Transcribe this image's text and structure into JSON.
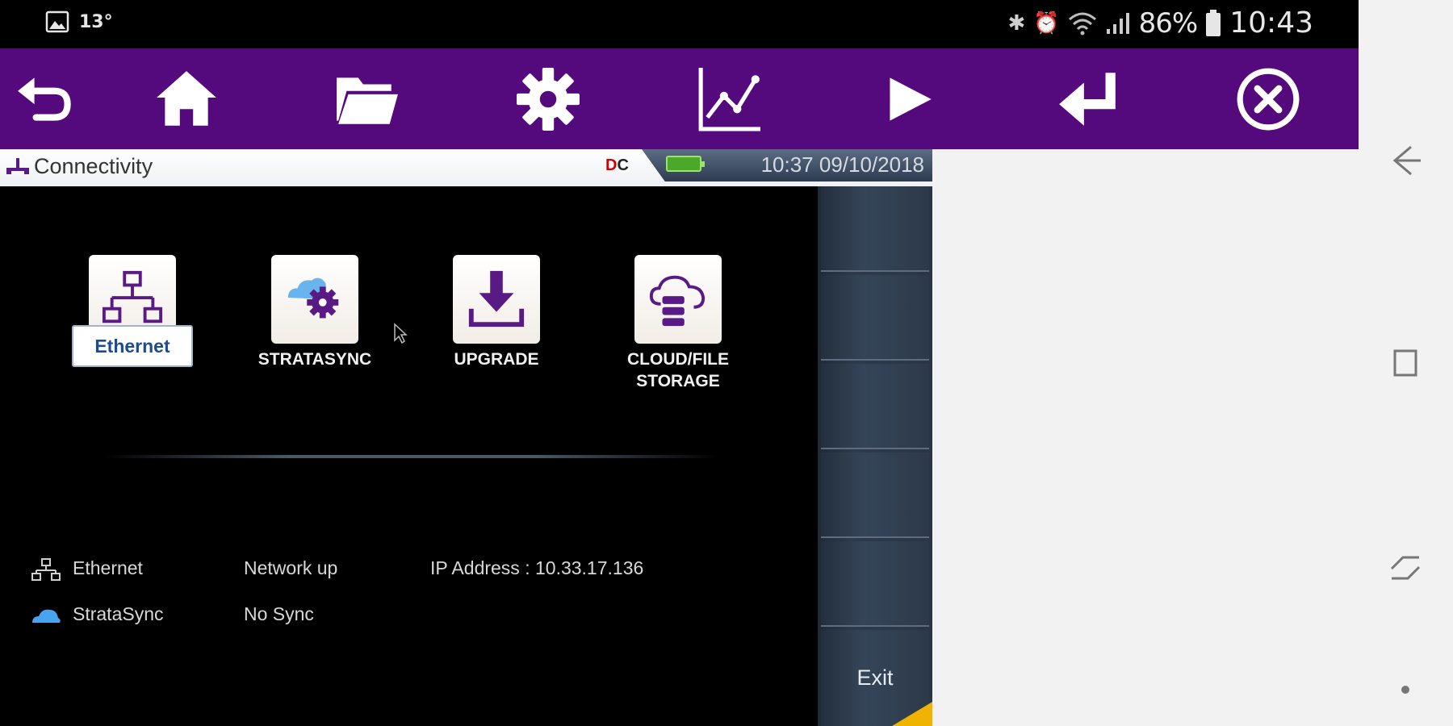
{
  "status_bar": {
    "temperature": "13°",
    "battery_percent": "86%",
    "clock": "10:43"
  },
  "toolbar": {
    "buttons": [
      {
        "name": "back-arrow-icon"
      },
      {
        "name": "home-icon"
      },
      {
        "name": "folder-icon"
      },
      {
        "name": "gear-icon"
      },
      {
        "name": "chart-icon"
      },
      {
        "name": "play-icon"
      },
      {
        "name": "enter-icon"
      },
      {
        "name": "close-circle-icon"
      }
    ],
    "color": "#540a7c"
  },
  "device": {
    "title": "Connectivity",
    "badge_prefix": "D",
    "badge_suffix": "C",
    "datetime": "10:37  09/10/2018",
    "tiles": [
      {
        "label": "Ethernet"
      },
      {
        "label": "STRATASYNC"
      },
      {
        "label": "UPGRADE"
      },
      {
        "label_line1": "CLOUD/FILE",
        "label_line2": "STORAGE"
      }
    ],
    "status": [
      {
        "name": "Ethernet",
        "state": "Network up",
        "ip": "IP Address : 10.33.17.136"
      },
      {
        "name": "StrataSync",
        "state": "No Sync"
      }
    ],
    "softkeys": {
      "exit_label": "Exit"
    }
  },
  "accent_colors": {
    "tile_icon": "#5a1a86",
    "selected_label": "#1c4b91"
  }
}
